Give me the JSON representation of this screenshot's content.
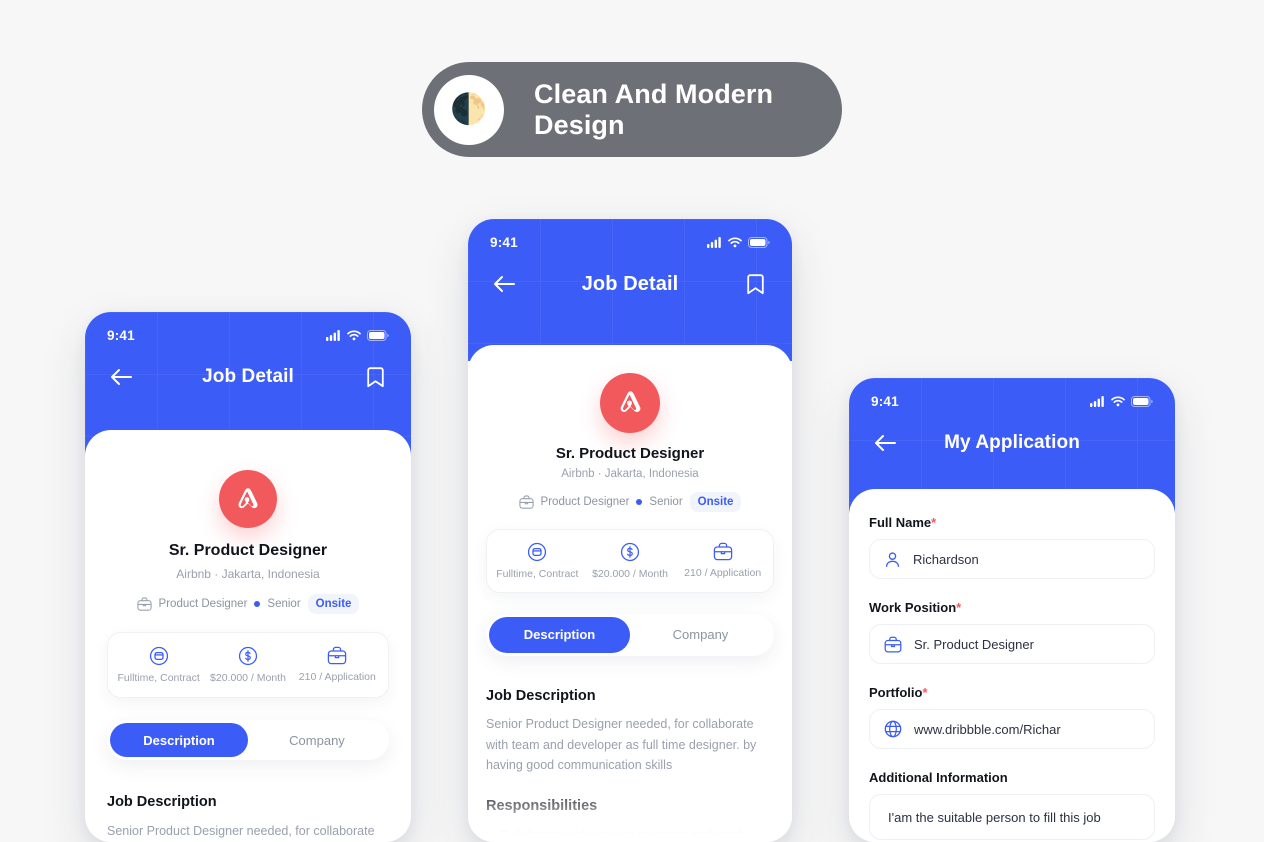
{
  "banner": {
    "title": "Clean And Modern Design",
    "icon": "half-moon-icon",
    "moon_glyph": "🌓",
    "bg_color": "#6E7078"
  },
  "theme": {
    "page_bg": "#F7F7F7",
    "primary_blue": "#3B5CF6",
    "accent_red": "#F2595C",
    "muted_text": "#9AA0AD",
    "dark_text": "#12141D"
  },
  "status_bar": {
    "time": "9:41",
    "icons": [
      "signal-icon",
      "wifi-icon",
      "battery-icon"
    ]
  },
  "job": {
    "company_logo": "airbnb-logo-icon",
    "title": "Sr. Product Designer",
    "meta": "Airbnb  ·  Jakarta, Indonesia",
    "tags": {
      "briefcase_icon": "briefcase-icon",
      "category": "Product Designer",
      "level": "Senior",
      "badge": "Onsite"
    },
    "info": [
      {
        "icon": "clock-circle-icon",
        "label": "Fulltime, Contract"
      },
      {
        "icon": "dollar-circle-icon",
        "label": "$20.000 / Month"
      },
      {
        "icon": "briefcase-icon",
        "label": "210 / Application"
      }
    ],
    "tabs": [
      {
        "label": "Description",
        "active": true
      },
      {
        "label": "Company",
        "active": false
      }
    ],
    "description_heading": "Job Description",
    "description_body": "Senior Product Designer needed, for collaborate with team and developer as full time designer. by having good communication skills",
    "description_body_short": "Senior Product Designer needed, for collaborate",
    "responsibilities_heading": "Responsibilities",
    "responsibilities": [
      "Collaborate with product manager and teach"
    ]
  },
  "screens": {
    "job_detail": {
      "nav_title": "Job Detail",
      "back_icon": "arrow-left-icon",
      "bookmark_icon": "bookmark-icon"
    },
    "my_application": {
      "nav_title": "My Application",
      "back_icon": "arrow-left-icon",
      "fields": [
        {
          "label": "Full Name",
          "required": true,
          "icon": "user-icon",
          "value": "Richardson"
        },
        {
          "label": "Work Position",
          "required": true,
          "icon": "briefcase-icon",
          "value": "Sr. Product Designer"
        },
        {
          "label": "Portfolio",
          "required": true,
          "icon": "globe-icon",
          "value": "www.dribbble.com/Richar"
        },
        {
          "label": "Additional Information",
          "required": false,
          "icon": "none",
          "value": "I'am the suitable  person to fill this job"
        }
      ]
    }
  }
}
